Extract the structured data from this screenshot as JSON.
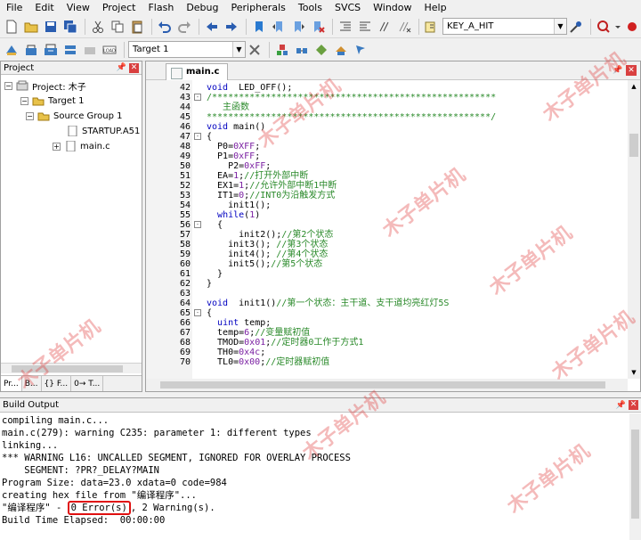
{
  "menu": [
    "File",
    "Edit",
    "View",
    "Project",
    "Flash",
    "Debug",
    "Peripherals",
    "Tools",
    "SVCS",
    "Window",
    "Help"
  ],
  "toolbar": {
    "find_combo_value": "KEY_A_HIT",
    "target_combo_value": "Target 1",
    "load_label": "LOAD"
  },
  "project_panel": {
    "title": "Project",
    "root": "Project: 木子",
    "target": "Target 1",
    "group": "Source Group 1",
    "files": [
      "STARTUP.A51",
      "main.c"
    ],
    "tabs": [
      "Pr...",
      "B...",
      "{} F...",
      "0→ T..."
    ]
  },
  "editor": {
    "active_tab": "main.c",
    "lines": [
      {
        "n": "42",
        "fold": "",
        "parts": [
          [
            "c-kw",
            "void"
          ],
          [
            "c-plain",
            "  LED_OFF();"
          ]
        ]
      },
      {
        "n": "43",
        "fold": "-",
        "parts": [
          [
            "c-com",
            "/*****************************************************"
          ]
        ]
      },
      {
        "n": "44",
        "fold": "",
        "parts": [
          [
            "c-com",
            "   主函数"
          ]
        ]
      },
      {
        "n": "45",
        "fold": "",
        "parts": [
          [
            "c-com",
            "*****************************************************/"
          ]
        ]
      },
      {
        "n": "46",
        "fold": "",
        "parts": [
          [
            "c-kw",
            "void"
          ],
          [
            "c-plain",
            " main()"
          ]
        ]
      },
      {
        "n": "47",
        "fold": "-",
        "parts": [
          [
            "c-plain",
            "{"
          ]
        ]
      },
      {
        "n": "48",
        "fold": "",
        "parts": [
          [
            "c-plain",
            "  P0="
          ],
          [
            "c-num",
            "0XFF"
          ],
          [
            "c-plain",
            ";"
          ]
        ]
      },
      {
        "n": "49",
        "fold": "",
        "parts": [
          [
            "c-plain",
            "  P1="
          ],
          [
            "c-num",
            "0xFF"
          ],
          [
            "c-plain",
            ";"
          ]
        ]
      },
      {
        "n": "50",
        "fold": "",
        "parts": [
          [
            "c-plain",
            "    P2="
          ],
          [
            "c-num",
            "0xFF"
          ],
          [
            "c-plain",
            ";"
          ]
        ]
      },
      {
        "n": "51",
        "fold": "",
        "parts": [
          [
            "c-plain",
            "  EA="
          ],
          [
            "c-num",
            "1"
          ],
          [
            "c-plain",
            ";"
          ],
          [
            "c-com",
            "//打开外部中断"
          ]
        ]
      },
      {
        "n": "52",
        "fold": "",
        "parts": [
          [
            "c-plain",
            "  EX1="
          ],
          [
            "c-num",
            "1"
          ],
          [
            "c-plain",
            ";"
          ],
          [
            "c-com",
            "//允许外部中断1中断"
          ]
        ]
      },
      {
        "n": "53",
        "fold": "",
        "parts": [
          [
            "c-plain",
            "  IT1="
          ],
          [
            "c-num",
            "0"
          ],
          [
            "c-plain",
            ";"
          ],
          [
            "c-com",
            "//INT0为沿触发方式"
          ]
        ]
      },
      {
        "n": "54",
        "fold": "",
        "parts": [
          [
            "c-plain",
            "    init1();"
          ]
        ]
      },
      {
        "n": "55",
        "fold": "",
        "parts": [
          [
            "c-plain",
            "  "
          ],
          [
            "c-kw",
            "while"
          ],
          [
            "c-plain",
            "("
          ],
          [
            "c-num",
            "1"
          ],
          [
            "c-plain",
            ")"
          ]
        ]
      },
      {
        "n": "56",
        "fold": "-",
        "parts": [
          [
            "c-plain",
            "  {"
          ]
        ]
      },
      {
        "n": "57",
        "fold": "",
        "parts": [
          [
            "c-plain",
            "      init2();"
          ],
          [
            "c-com",
            "//第2个状态"
          ]
        ]
      },
      {
        "n": "58",
        "fold": "",
        "parts": [
          [
            "c-plain",
            "    init3(); "
          ],
          [
            "c-com",
            "//第3个状态"
          ]
        ]
      },
      {
        "n": "59",
        "fold": "",
        "parts": [
          [
            "c-plain",
            "    init4(); "
          ],
          [
            "c-com",
            "//第4个状态"
          ]
        ]
      },
      {
        "n": "60",
        "fold": "",
        "parts": [
          [
            "c-plain",
            "    init5();"
          ],
          [
            "c-com",
            "//第5个状态"
          ]
        ]
      },
      {
        "n": "61",
        "fold": "",
        "parts": [
          [
            "c-plain",
            "  }"
          ]
        ]
      },
      {
        "n": "62",
        "fold": "",
        "parts": [
          [
            "c-plain",
            "}"
          ]
        ]
      },
      {
        "n": "63",
        "fold": "",
        "parts": [
          [
            "c-plain",
            ""
          ]
        ]
      },
      {
        "n": "64",
        "fold": "",
        "parts": [
          [
            "c-kw",
            "void"
          ],
          [
            "c-plain",
            "  init1()"
          ],
          [
            "c-com",
            "//第一个状态：主干道、支干道均亮红灯5S"
          ]
        ]
      },
      {
        "n": "65",
        "fold": "-",
        "parts": [
          [
            "c-plain",
            "{"
          ]
        ]
      },
      {
        "n": "66",
        "fold": "",
        "parts": [
          [
            "c-plain",
            "  "
          ],
          [
            "c-kw",
            "uint"
          ],
          [
            "c-plain",
            " temp;"
          ]
        ]
      },
      {
        "n": "67",
        "fold": "",
        "parts": [
          [
            "c-plain",
            "  temp="
          ],
          [
            "c-num",
            "6"
          ],
          [
            "c-plain",
            ";"
          ],
          [
            "c-com",
            "//变量赋初值"
          ]
        ]
      },
      {
        "n": "68",
        "fold": "",
        "parts": [
          [
            "c-plain",
            "  TMOD="
          ],
          [
            "c-num",
            "0x01"
          ],
          [
            "c-plain",
            ";"
          ],
          [
            "c-com",
            "//定时器0工作于方式1"
          ]
        ]
      },
      {
        "n": "69",
        "fold": "",
        "parts": [
          [
            "c-plain",
            "  TH0="
          ],
          [
            "c-num",
            "0x4c"
          ],
          [
            "c-plain",
            ";"
          ]
        ]
      },
      {
        "n": "70",
        "fold": "",
        "parts": [
          [
            "c-plain",
            "  TL0="
          ],
          [
            "c-num",
            "0x00"
          ],
          [
            "c-plain",
            ";"
          ],
          [
            "c-com",
            "//定时器赋初值"
          ]
        ]
      }
    ]
  },
  "build_output": {
    "title": "Build Output",
    "lines": [
      "compiling main.c...",
      "main.c(279): warning C235: parameter 1: different types",
      "linking...",
      "*** WARNING L16: UNCALLED SEGMENT, IGNORED FOR OVERLAY PROCESS",
      "    SEGMENT: ?PR?_DELAY?MAIN",
      "Program Size: data=23.0 xdata=0 code=984",
      "creating hex file from \"编译程序\"..."
    ],
    "result_prefix": "\"编译程序\" - ",
    "result_errors": "0 Error(s)",
    "result_suffix": ", 2 Warning(s).",
    "elapsed": "Build Time Elapsed:  00:00:00"
  },
  "watermark": "木子单片机",
  "colors": {
    "error_highlight": "#e01010",
    "keyword": "#0000c0",
    "comment": "#2a8a2a",
    "number": "#7a1fa2"
  }
}
